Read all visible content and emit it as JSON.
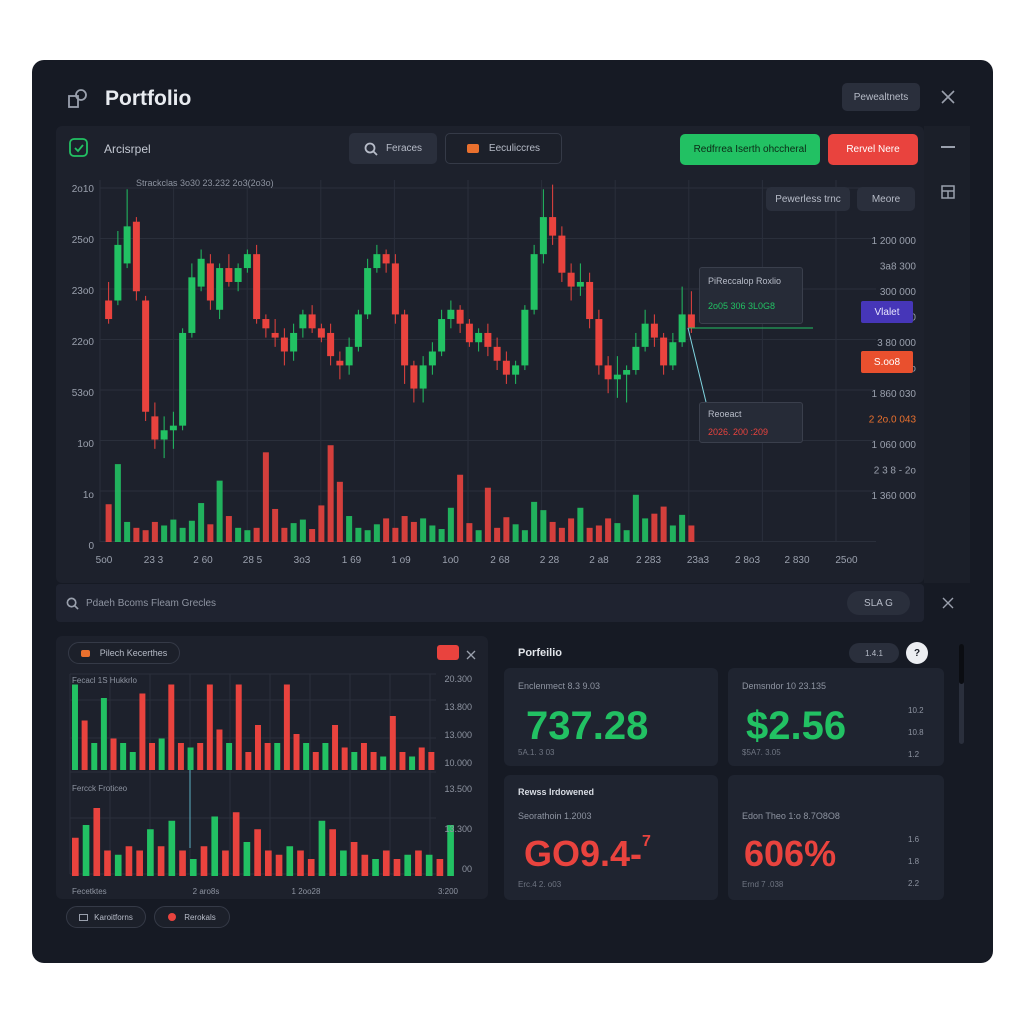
{
  "app": {
    "title": "Portfolio",
    "header_button": "Pewealtnets"
  },
  "toolbar": {
    "account_label": "Arcisrpel",
    "search_button": "Feraces",
    "orders_button": "Eeculiccres",
    "buy_button": "Redfrrea Iserth ohccheral",
    "sell_button": "Rervel Nere"
  },
  "chart_controls": {
    "time_button": "Pewerless trnc",
    "more_button": "Meore"
  },
  "chart_caption": "Strackclas  3o30  23.232  2o3(2o3o)",
  "tooltip_top": {
    "title": "PiReccalop Roxlio",
    "value": "2o05 306 3L0G8"
  },
  "tooltip_bottom": {
    "title": "Reoeact",
    "value": "2026. 200 :209"
  },
  "badges": {
    "blue": "Vlalet",
    "orange": "S.oo8"
  },
  "colors": {
    "up": "#22c163",
    "down": "#e9433e",
    "accent_blue": "#4636b8",
    "accent_orange": "#e9502e"
  },
  "chart_data": {
    "type": "candlestick",
    "y_ticks": [
      "2o10",
      "25o0",
      "23o0",
      "22o0",
      "53o0",
      "1o0",
      "1o",
      "0"
    ],
    "right_ticks": [
      "1 200 000",
      "3a8 300",
      "300 000",
      "300 000",
      "3 80 000",
      "3 o.3 o",
      "1 860 030",
      "2 2o.0 043",
      "1 060 000",
      "2 3 8 - 2o",
      "1 360 000"
    ],
    "x_ticks": [
      "5o0",
      "23 3",
      "2 60",
      "28 5",
      "3o3",
      "1 69",
      "1 o9",
      "1o0",
      "2 68",
      "2 28",
      "2 a8",
      "2 283",
      "23a3",
      "2 8o3",
      "2 830",
      "25o0"
    ],
    "candles": [
      {
        "o": 2180,
        "c": 2220,
        "h": 2260,
        "l": 2170,
        "up": false
      },
      {
        "o": 2220,
        "c": 2340,
        "h": 2370,
        "l": 2210,
        "up": true
      },
      {
        "o": 2300,
        "c": 2380,
        "h": 2460,
        "l": 2290,
        "up": true
      },
      {
        "o": 2390,
        "c": 2240,
        "h": 2400,
        "l": 2220,
        "up": false
      },
      {
        "o": 2220,
        "c": 1980,
        "h": 2230,
        "l": 1960,
        "up": false
      },
      {
        "o": 1970,
        "c": 1920,
        "h": 2000,
        "l": 1900,
        "up": false
      },
      {
        "o": 1920,
        "c": 1940,
        "h": 1970,
        "l": 1880,
        "up": true
      },
      {
        "o": 1940,
        "c": 1950,
        "h": 1980,
        "l": 1900,
        "up": true
      },
      {
        "o": 1950,
        "c": 2150,
        "h": 2160,
        "l": 1940,
        "up": true
      },
      {
        "o": 2150,
        "c": 2270,
        "h": 2300,
        "l": 2140,
        "up": true
      },
      {
        "o": 2250,
        "c": 2310,
        "h": 2330,
        "l": 2240,
        "up": true
      },
      {
        "o": 2300,
        "c": 2220,
        "h": 2320,
        "l": 2200,
        "up": false
      },
      {
        "o": 2200,
        "c": 2290,
        "h": 2300,
        "l": 2180,
        "up": true
      },
      {
        "o": 2290,
        "c": 2260,
        "h": 2320,
        "l": 2250,
        "up": false
      },
      {
        "o": 2260,
        "c": 2290,
        "h": 2300,
        "l": 2240,
        "up": true
      },
      {
        "o": 2290,
        "c": 2320,
        "h": 2330,
        "l": 2280,
        "up": true
      },
      {
        "o": 2320,
        "c": 2180,
        "h": 2340,
        "l": 2170,
        "up": false
      },
      {
        "o": 2180,
        "c": 2160,
        "h": 2190,
        "l": 2140,
        "up": false
      },
      {
        "o": 2150,
        "c": 2140,
        "h": 2180,
        "l": 2120,
        "up": false
      },
      {
        "o": 2140,
        "c": 2110,
        "h": 2160,
        "l": 2080,
        "up": false
      },
      {
        "o": 2110,
        "c": 2150,
        "h": 2170,
        "l": 2090,
        "up": true
      },
      {
        "o": 2160,
        "c": 2190,
        "h": 2200,
        "l": 2140,
        "up": true
      },
      {
        "o": 2190,
        "c": 2160,
        "h": 2210,
        "l": 2150,
        "up": false
      },
      {
        "o": 2160,
        "c": 2140,
        "h": 2170,
        "l": 2130,
        "up": false
      },
      {
        "o": 2150,
        "c": 2100,
        "h": 2170,
        "l": 2080,
        "up": false
      },
      {
        "o": 2090,
        "c": 2080,
        "h": 2110,
        "l": 2050,
        "up": false
      },
      {
        "o": 2080,
        "c": 2120,
        "h": 2140,
        "l": 2060,
        "up": true
      },
      {
        "o": 2120,
        "c": 2190,
        "h": 2200,
        "l": 2110,
        "up": true
      },
      {
        "o": 2190,
        "c": 2290,
        "h": 2310,
        "l": 2180,
        "up": true
      },
      {
        "o": 2290,
        "c": 2320,
        "h": 2340,
        "l": 2280,
        "up": true
      },
      {
        "o": 2320,
        "c": 2300,
        "h": 2330,
        "l": 2280,
        "up": false
      },
      {
        "o": 2300,
        "c": 2190,
        "h": 2320,
        "l": 2170,
        "up": false
      },
      {
        "o": 2190,
        "c": 2080,
        "h": 2200,
        "l": 2040,
        "up": false
      },
      {
        "o": 2080,
        "c": 2030,
        "h": 2090,
        "l": 2000,
        "up": false
      },
      {
        "o": 2030,
        "c": 2080,
        "h": 2100,
        "l": 2000,
        "up": true
      },
      {
        "o": 2080,
        "c": 2110,
        "h": 2130,
        "l": 2060,
        "up": true
      },
      {
        "o": 2110,
        "c": 2180,
        "h": 2200,
        "l": 2100,
        "up": true
      },
      {
        "o": 2180,
        "c": 2200,
        "h": 2220,
        "l": 2160,
        "up": true
      },
      {
        "o": 2200,
        "c": 2170,
        "h": 2210,
        "l": 2150,
        "up": false
      },
      {
        "o": 2170,
        "c": 2130,
        "h": 2180,
        "l": 2120,
        "up": false
      },
      {
        "o": 2130,
        "c": 2150,
        "h": 2160,
        "l": 2110,
        "up": true
      },
      {
        "o": 2150,
        "c": 2120,
        "h": 2170,
        "l": 2100,
        "up": false
      },
      {
        "o": 2120,
        "c": 2090,
        "h": 2140,
        "l": 2070,
        "up": false
      },
      {
        "o": 2090,
        "c": 2060,
        "h": 2110,
        "l": 2040,
        "up": false
      },
      {
        "o": 2060,
        "c": 2080,
        "h": 2090,
        "l": 2040,
        "up": true
      },
      {
        "o": 2080,
        "c": 2200,
        "h": 2210,
        "l": 2070,
        "up": true
      },
      {
        "o": 2200,
        "c": 2320,
        "h": 2340,
        "l": 2190,
        "up": true
      },
      {
        "o": 2320,
        "c": 2400,
        "h": 2460,
        "l": 2300,
        "up": true
      },
      {
        "o": 2400,
        "c": 2360,
        "h": 2470,
        "l": 2340,
        "up": false
      },
      {
        "o": 2360,
        "c": 2280,
        "h": 2380,
        "l": 2260,
        "up": false
      },
      {
        "o": 2280,
        "c": 2250,
        "h": 2300,
        "l": 2220,
        "up": false
      },
      {
        "o": 2250,
        "c": 2260,
        "h": 2300,
        "l": 2230,
        "up": true
      },
      {
        "o": 2260,
        "c": 2180,
        "h": 2280,
        "l": 2160,
        "up": false
      },
      {
        "o": 2180,
        "c": 2080,
        "h": 2200,
        "l": 2060,
        "up": false
      },
      {
        "o": 2080,
        "c": 2050,
        "h": 2100,
        "l": 2020,
        "up": false
      },
      {
        "o": 2050,
        "c": 2060,
        "h": 2100,
        "l": 2010,
        "up": true
      },
      {
        "o": 2060,
        "c": 2070,
        "h": 2080,
        "l": 2000,
        "up": true
      },
      {
        "o": 2070,
        "c": 2120,
        "h": 2150,
        "l": 2060,
        "up": true
      },
      {
        "o": 2120,
        "c": 2170,
        "h": 2200,
        "l": 2110,
        "up": true
      },
      {
        "o": 2170,
        "c": 2140,
        "h": 2190,
        "l": 2120,
        "up": false
      },
      {
        "o": 2140,
        "c": 2080,
        "h": 2150,
        "l": 2060,
        "up": false
      },
      {
        "o": 2080,
        "c": 2130,
        "h": 2150,
        "l": 2070,
        "up": true
      },
      {
        "o": 2130,
        "c": 2190,
        "h": 2250,
        "l": 2120,
        "up": true
      },
      {
        "o": 2190,
        "c": 2160,
        "h": 2240,
        "l": 2150,
        "up": false
      }
    ],
    "volume": [
      0.32,
      0.66,
      0.17,
      0.12,
      0.1,
      0.17,
      0.14,
      0.19,
      0.12,
      0.18,
      0.33,
      0.15,
      0.52,
      0.22,
      0.12,
      0.1,
      0.12,
      0.76,
      0.28,
      0.12,
      0.16,
      0.19,
      0.11,
      0.31,
      0.82,
      0.51,
      0.22,
      0.12,
      0.1,
      0.15,
      0.2,
      0.12,
      0.22,
      0.17,
      0.2,
      0.14,
      0.11,
      0.29,
      0.57,
      0.16,
      0.1,
      0.46,
      0.12,
      0.21,
      0.15,
      0.1,
      0.34,
      0.27,
      0.17,
      0.12,
      0.2,
      0.29,
      0.12,
      0.14,
      0.2,
      0.16,
      0.1,
      0.4,
      0.2,
      0.24,
      0.3,
      0.14,
      0.23,
      0.14
    ]
  },
  "search_bar": {
    "placeholder": "Pdaeh Bcoms Fleam Grecles",
    "button": "SLA G"
  },
  "panel_left": {
    "tag": "Pilech Kecerthes",
    "top_label": "Fecacl  1S Hukkrlo",
    "bottom_label": "Fercck  Froticeo",
    "right_ticks_top": [
      "20.300",
      "13.800",
      "13.000",
      "10.000"
    ],
    "right_ticks_bottom": [
      "13.500",
      "13.300",
      "00"
    ],
    "x_ticks": [
      "Fecetktes",
      "2 aro8s",
      "1 2oo28",
      "3:200"
    ],
    "bars_top": [
      {
        "h": 0.95,
        "up": true
      },
      {
        "h": 0.55,
        "up": false
      },
      {
        "h": 0.3,
        "up": true
      },
      {
        "h": 0.8,
        "up": true
      },
      {
        "h": 0.35,
        "up": false
      },
      {
        "h": 0.3,
        "up": true
      },
      {
        "h": 0.2,
        "up": true
      },
      {
        "h": 0.85,
        "up": false
      },
      {
        "h": 0.3,
        "up": false
      },
      {
        "h": 0.35,
        "up": true
      },
      {
        "h": 0.95,
        "up": false
      },
      {
        "h": 0.3,
        "up": false
      },
      {
        "h": 0.25,
        "up": true
      },
      {
        "h": 0.3,
        "up": false
      },
      {
        "h": 0.95,
        "up": false
      },
      {
        "h": 0.45,
        "up": false
      },
      {
        "h": 0.3,
        "up": true
      },
      {
        "h": 0.95,
        "up": false
      },
      {
        "h": 0.2,
        "up": false
      },
      {
        "h": 0.5,
        "up": false
      },
      {
        "h": 0.3,
        "up": false
      },
      {
        "h": 0.3,
        "up": true
      },
      {
        "h": 0.95,
        "up": false
      },
      {
        "h": 0.4,
        "up": false
      },
      {
        "h": 0.3,
        "up": true
      },
      {
        "h": 0.2,
        "up": false
      },
      {
        "h": 0.3,
        "up": true
      },
      {
        "h": 0.5,
        "up": false
      },
      {
        "h": 0.25,
        "up": false
      },
      {
        "h": 0.2,
        "up": true
      },
      {
        "h": 0.3,
        "up": false
      },
      {
        "h": 0.2,
        "up": false
      },
      {
        "h": 0.15,
        "up": true
      },
      {
        "h": 0.6,
        "up": false
      },
      {
        "h": 0.2,
        "up": false
      },
      {
        "h": 0.15,
        "up": true
      },
      {
        "h": 0.25,
        "up": false
      },
      {
        "h": 0.2,
        "up": false
      }
    ],
    "bars_bottom": [
      {
        "h": 0.45,
        "up": false
      },
      {
        "h": 0.6,
        "up": true
      },
      {
        "h": 0.8,
        "up": false
      },
      {
        "h": 0.3,
        "up": false
      },
      {
        "h": 0.25,
        "up": true
      },
      {
        "h": 0.35,
        "up": false
      },
      {
        "h": 0.3,
        "up": false
      },
      {
        "h": 0.55,
        "up": true
      },
      {
        "h": 0.35,
        "up": false
      },
      {
        "h": 0.65,
        "up": true
      },
      {
        "h": 0.3,
        "up": false
      },
      {
        "h": 0.2,
        "up": true
      },
      {
        "h": 0.35,
        "up": false
      },
      {
        "h": 0.7,
        "up": true
      },
      {
        "h": 0.3,
        "up": false
      },
      {
        "h": 0.75,
        "up": false
      },
      {
        "h": 0.4,
        "up": true
      },
      {
        "h": 0.55,
        "up": false
      },
      {
        "h": 0.3,
        "up": false
      },
      {
        "h": 0.25,
        "up": false
      },
      {
        "h": 0.35,
        "up": true
      },
      {
        "h": 0.3,
        "up": false
      },
      {
        "h": 0.2,
        "up": false
      },
      {
        "h": 0.65,
        "up": true
      },
      {
        "h": 0.55,
        "up": false
      },
      {
        "h": 0.3,
        "up": true
      },
      {
        "h": 0.4,
        "up": false
      },
      {
        "h": 0.25,
        "up": false
      },
      {
        "h": 0.2,
        "up": true
      },
      {
        "h": 0.3,
        "up": false
      },
      {
        "h": 0.2,
        "up": false
      },
      {
        "h": 0.25,
        "up": true
      },
      {
        "h": 0.3,
        "up": false
      },
      {
        "h": 0.25,
        "up": true
      },
      {
        "h": 0.2,
        "up": false
      },
      {
        "h": 0.6,
        "up": true
      }
    ]
  },
  "portfolio_panel": {
    "title": "Porfeilio",
    "pill": "1.4.1",
    "section2_title": "Rewss Irdowened",
    "card1": {
      "label": "Enclenmect  8.3 9.03",
      "value": "737.28",
      "sub": "5A.1. 3 03"
    },
    "card2": {
      "label": "Demsndor  10 23.135",
      "value": "$2.56",
      "sub": "$5A7. 3.05",
      "side": [
        "10.2",
        "10.8",
        "1.2"
      ]
    },
    "card3": {
      "label": "Seorathoin  1.2003",
      "value": "GO9.4-",
      "suffix": "7",
      "sub": "Erc.4 2. o03"
    },
    "card4": {
      "label": "Edon Theo  1:o 8.7O8O8",
      "value": "606%",
      "sub": "Ernd 7 .038",
      "side": [
        "1.6",
        "1.8",
        "2.2"
      ]
    }
  },
  "footer_buttons": {
    "left": "Karoitforns",
    "right": "Rerokals"
  }
}
